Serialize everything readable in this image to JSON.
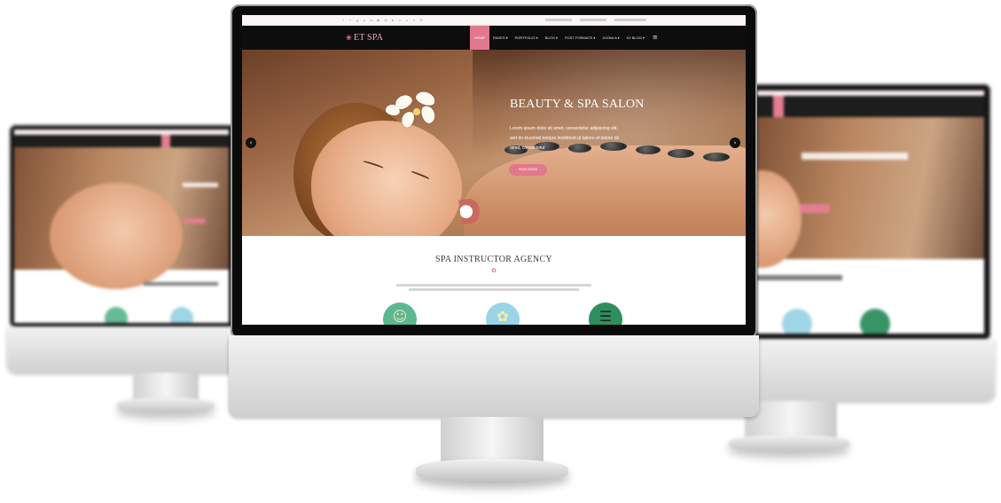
{
  "topbar": {
    "social_icons": [
      "facebook-icon",
      "twitter-icon",
      "google-plus-icon",
      "pinterest-icon",
      "linkedin-icon",
      "youtube-icon",
      "instagram-icon",
      "dribbble-icon",
      "flickr-icon",
      "skype-icon",
      "vimeo-icon",
      "rss-icon"
    ],
    "social_glyphs": [
      "f",
      "t",
      "g",
      "p",
      "in",
      "▶",
      "◎",
      "●",
      "∞",
      "s",
      "v",
      "≋"
    ]
  },
  "navbar": {
    "logo_symbol": "❀",
    "logo_text": "ET SPA",
    "items": [
      {
        "label": "HOME",
        "active": true
      },
      {
        "label": "PAGES ▾",
        "active": false
      },
      {
        "label": "PORTFOLIO ▾",
        "active": false
      },
      {
        "label": "BLOG ▾",
        "active": false
      },
      {
        "label": "POST FORMATS ▾",
        "active": false
      },
      {
        "label": "JOOMLA ▾",
        "active": false
      },
      {
        "label": "K2 BLOG ▾",
        "active": false
      }
    ],
    "menu_glyph": "≡"
  },
  "hero": {
    "title": "BEAUTY & SPA SALON",
    "description": "Lorem ipsum dolor sit amet, consectetur adipiscing elit, sed do eiusmod tempor incididunt ut labore et dolore sit amet, consectetur",
    "button_label": "READ MORE",
    "prev_glyph": "‹",
    "next_glyph": "›"
  },
  "section": {
    "title": "SPA INSTRUCTOR AGENCY",
    "lotus_glyph": "✿"
  },
  "features": [
    {
      "icon": "spa-woman-icon",
      "glyph": "☺",
      "bg": "#5cb88f",
      "fg": "#f2e2c8"
    },
    {
      "icon": "lotus-icon",
      "glyph": "✿",
      "bg": "#9ad4e6",
      "fg": "#f8f0a0"
    },
    {
      "icon": "hot-stones-icon",
      "glyph": "☰",
      "bg": "#2e8f5e",
      "fg": "#222222"
    }
  ],
  "colors": {
    "accent": "#e2788c",
    "nav_bg": "#0d0d0d",
    "topbar_bg": "#fbf5f5"
  },
  "device": {
    "logo_glyph": ""
  }
}
